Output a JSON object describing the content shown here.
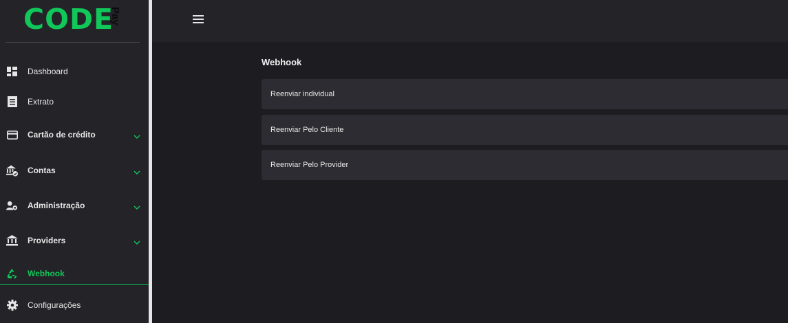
{
  "brand": {
    "logo_text": "CODE",
    "logo_sub": "Pay",
    "accent_color": "#11c75a"
  },
  "sidebar": {
    "items": [
      {
        "label": "Dashboard",
        "icon": "dashboard-icon",
        "bold": false,
        "has_chevron": false,
        "active": false
      },
      {
        "label": "Extrato",
        "icon": "receipt-icon",
        "bold": false,
        "has_chevron": false,
        "active": false
      },
      {
        "label": "Cartão de crédito",
        "icon": "credit-card-icon",
        "bold": true,
        "has_chevron": true,
        "active": false
      },
      {
        "label": "Contas",
        "icon": "bank-check-icon",
        "bold": true,
        "has_chevron": true,
        "active": false
      },
      {
        "label": "Administração",
        "icon": "user-gear-icon",
        "bold": true,
        "has_chevron": true,
        "active": false
      },
      {
        "label": "Providers",
        "icon": "bank-icon",
        "bold": true,
        "has_chevron": true,
        "active": false
      },
      {
        "label": "Webhook",
        "icon": "recycle-icon",
        "bold": true,
        "has_chevron": false,
        "active": true
      },
      {
        "label": "Configurações",
        "icon": "gear-icon",
        "bold": false,
        "has_chevron": false,
        "active": false
      }
    ]
  },
  "topbar": {
    "menu_icon": "hamburger-icon"
  },
  "main": {
    "title": "Webhook",
    "cards": [
      {
        "label": "Reenviar individual"
      },
      {
        "label": "Reenviar Pelo Cliente"
      },
      {
        "label": "Reenviar Pelo Provider"
      }
    ]
  }
}
